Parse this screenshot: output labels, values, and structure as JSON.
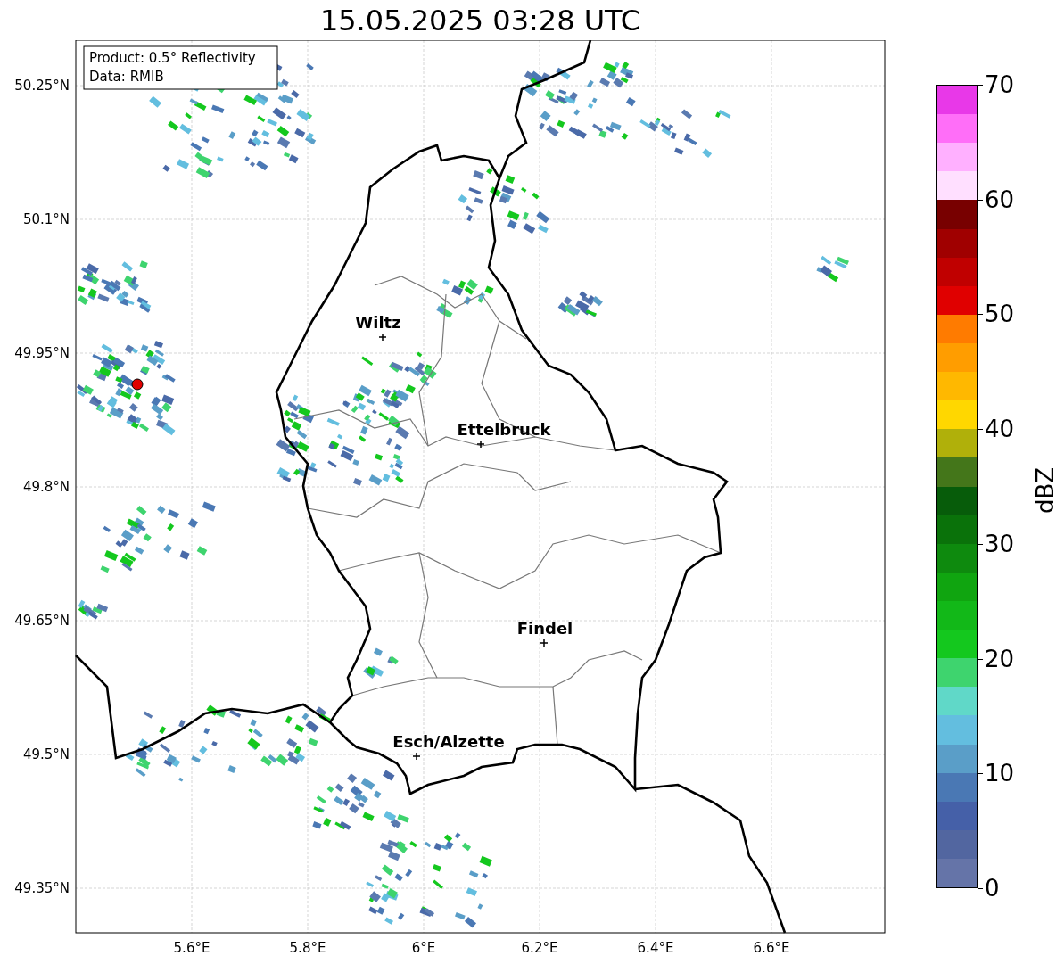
{
  "title": "15.05.2025 03:28 UTC",
  "legend": [
    "Product: 0.5° Reflectivity",
    "Data: RMIB"
  ],
  "x_ticks": [
    "5.6°E",
    "5.8°E",
    "6°E",
    "6.2°E",
    "6.4°E",
    "6.6°E"
  ],
  "y_ticks": [
    "50.25°N",
    "50.1°N",
    "49.95°N",
    "49.8°N",
    "49.65°N",
    "49.5°N",
    "49.35°N"
  ],
  "cities": [
    {
      "name": "Wiltz"
    },
    {
      "name": "Ettelbruck"
    },
    {
      "name": "Findel"
    },
    {
      "name": "Esch/Alzette"
    }
  ],
  "colorbar": {
    "label": "dBZ",
    "ticks": [
      "70",
      "60",
      "50",
      "40",
      "30",
      "20",
      "10",
      "0"
    ],
    "bands": [
      {
        "color": "#e838e8"
      },
      {
        "color": "#ff6ef8"
      },
      {
        "color": "#ffb0ff"
      },
      {
        "color": "#ffdfff"
      },
      {
        "color": "#780000"
      },
      {
        "color": "#a00000"
      },
      {
        "color": "#c00000"
      },
      {
        "color": "#e00000"
      },
      {
        "color": "#ff7b00"
      },
      {
        "color": "#ff9d00"
      },
      {
        "color": "#ffb800"
      },
      {
        "color": "#ffd700"
      },
      {
        "color": "#b0b00a"
      },
      {
        "color": "#44761a"
      },
      {
        "color": "#075c0a"
      },
      {
        "color": "#0a720a"
      },
      {
        "color": "#0e8a0e"
      },
      {
        "color": "#10a510"
      },
      {
        "color": "#12b818"
      },
      {
        "color": "#14c81e"
      },
      {
        "color": "#3ed46e"
      },
      {
        "color": "#60d8c8"
      },
      {
        "color": "#63bedf"
      },
      {
        "color": "#5a9ec8"
      },
      {
        "color": "#4a78b4"
      },
      {
        "color": "#4560a8"
      },
      {
        "color": "#5266a0"
      },
      {
        "color": "#6574a8"
      }
    ]
  }
}
